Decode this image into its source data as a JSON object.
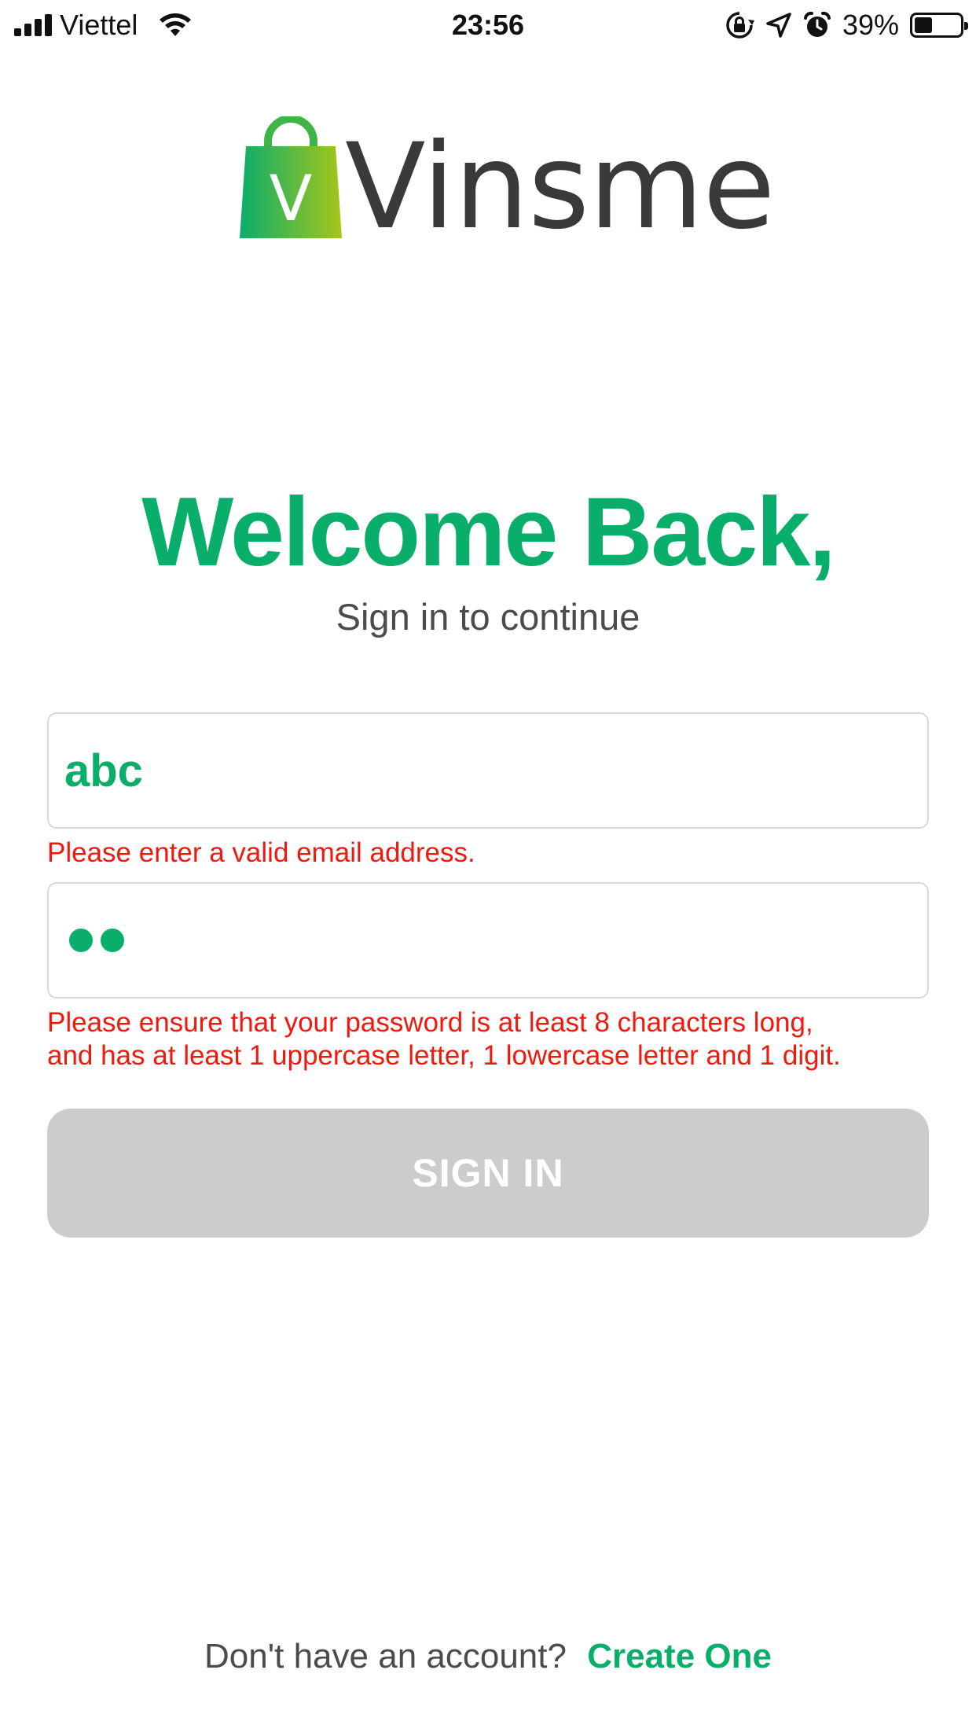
{
  "status_bar": {
    "carrier": "Viettel",
    "time": "23:56",
    "battery_percent": "39%",
    "battery_level": 0.39,
    "icons": [
      "signal-icon",
      "wifi-icon",
      "orientation-lock-icon",
      "location-icon",
      "alarm-icon",
      "battery-icon"
    ]
  },
  "logo": {
    "bag_letter": "V",
    "wordmark": "Vinsme"
  },
  "heading": {
    "title": "Welcome Back,",
    "subtitle": "Sign in to continue"
  },
  "form": {
    "email": {
      "value": "abc",
      "error": "Please enter a valid email address."
    },
    "password": {
      "masked_length": 2,
      "error_line1": "Please ensure that your password is at least 8 characters long,",
      "error_line2": "and has at least 1 uppercase letter, 1 lowercase letter and 1 digit."
    },
    "submit_label": "SIGN IN",
    "submit_enabled": false
  },
  "footer": {
    "question": "Don't have an account?",
    "link": "Create One"
  },
  "colors": {
    "brand_green": "#0aae6b",
    "error_red": "#f0190e",
    "disabled_button": "#cccccc",
    "text_dark": "#4b4b4b"
  }
}
